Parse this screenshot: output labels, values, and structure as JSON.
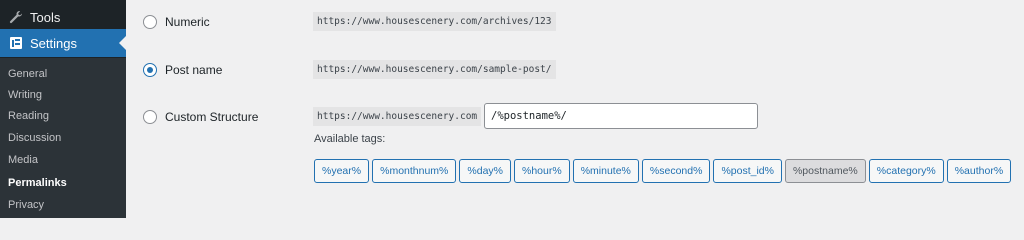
{
  "sidebar": {
    "tools_label": "Tools",
    "settings_label": "Settings",
    "submenu": [
      "General",
      "Writing",
      "Reading",
      "Discussion",
      "Media",
      "Permalinks",
      "Privacy"
    ],
    "current": "Permalinks"
  },
  "permalink_options": {
    "numeric": {
      "label": "Numeric",
      "example": "https://www.housescenery.com/archives/123",
      "selected": false
    },
    "post_name": {
      "label": "Post name",
      "example": "https://www.housescenery.com/sample-post/",
      "selected": true
    },
    "custom": {
      "label": "Custom Structure",
      "base_url": "https://www.housescenery.com",
      "value": "/%postname%/",
      "selected": false
    }
  },
  "available_tags": {
    "label": "Available tags:",
    "tags": [
      "%year%",
      "%monthnum%",
      "%day%",
      "%hour%",
      "%minute%",
      "%second%",
      "%post_id%",
      "%postname%",
      "%category%",
      "%author%"
    ],
    "active": "%postname%"
  },
  "colors": {
    "accent": "#2271b1",
    "sidebar_bg": "#1d2327",
    "page_bg": "#f0f0f1"
  }
}
